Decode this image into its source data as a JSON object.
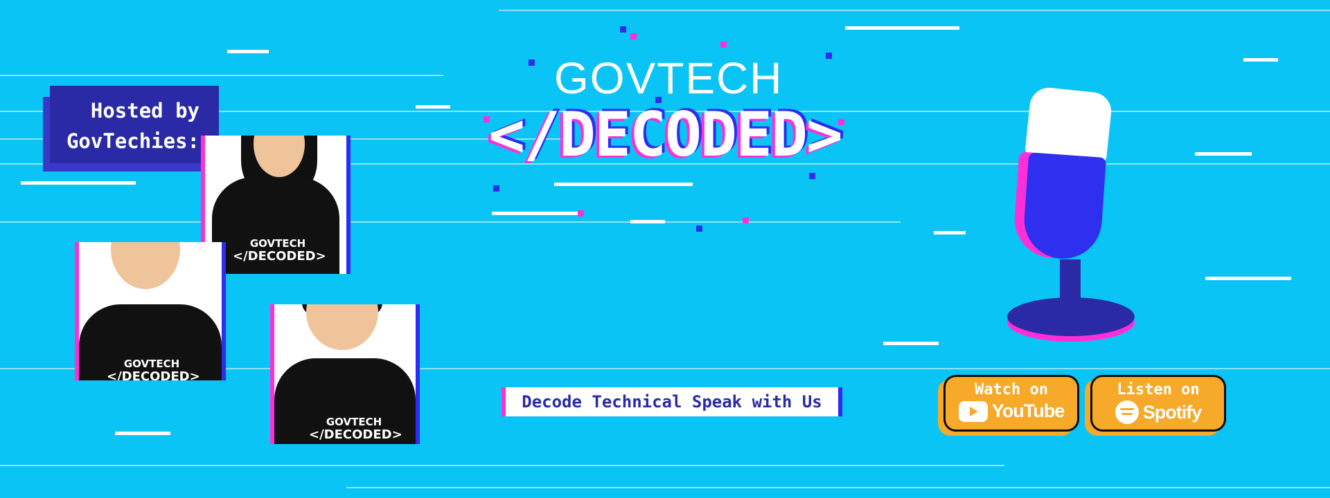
{
  "banner": {
    "background_color": "#0ac4f5",
    "accent_colors": {
      "navy": "#2a2aa6",
      "blue": "#2d2cf0",
      "pink": "#ff2fd8",
      "orange": "#f7a92a"
    }
  },
  "hosts": {
    "label_line1": "Hosted by",
    "label_line2": "GovTechies:",
    "shirt_logo_line1": "GOVTECH",
    "shirt_logo_line2": "</DECODED>"
  },
  "title": {
    "line1": "GOVTECH",
    "line2": "</DECODED>"
  },
  "tagline": "Decode Technical Speak with Us",
  "platforms": [
    {
      "caption": "Watch on",
      "brand": "YouTube",
      "icon": "youtube-play-icon"
    },
    {
      "caption": "Listen on",
      "brand": "Spotify",
      "icon": "spotify-icon"
    }
  ],
  "decor_icons": [
    "microphone-icon"
  ]
}
